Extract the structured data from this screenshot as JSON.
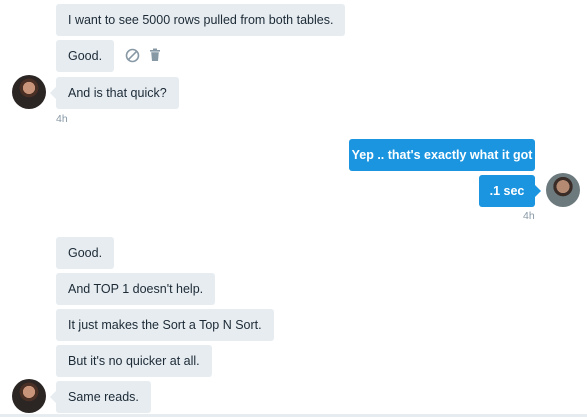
{
  "messages": {
    "m1": "I want to see 5000 rows pulled from both tables.",
    "m2": "Good.",
    "m3": "And is that quick?",
    "m3_time": "4h",
    "m4": "Yep .. that's exactly what it got",
    "m5": ".1 sec",
    "m5_time": "4h",
    "m6": "Good.",
    "m7": "And TOP 1 doesn't help.",
    "m8": "It just makes the Sort a Top N Sort.",
    "m9": "But it's no quicker at all.",
    "m10": "Same reads."
  },
  "icons": {
    "block": "block-icon",
    "delete": "trash-icon"
  },
  "colors": {
    "incoming_bubble": "#e6ecf0",
    "outgoing_bubble": "#1b95e0",
    "timestamp": "#8899a6"
  }
}
